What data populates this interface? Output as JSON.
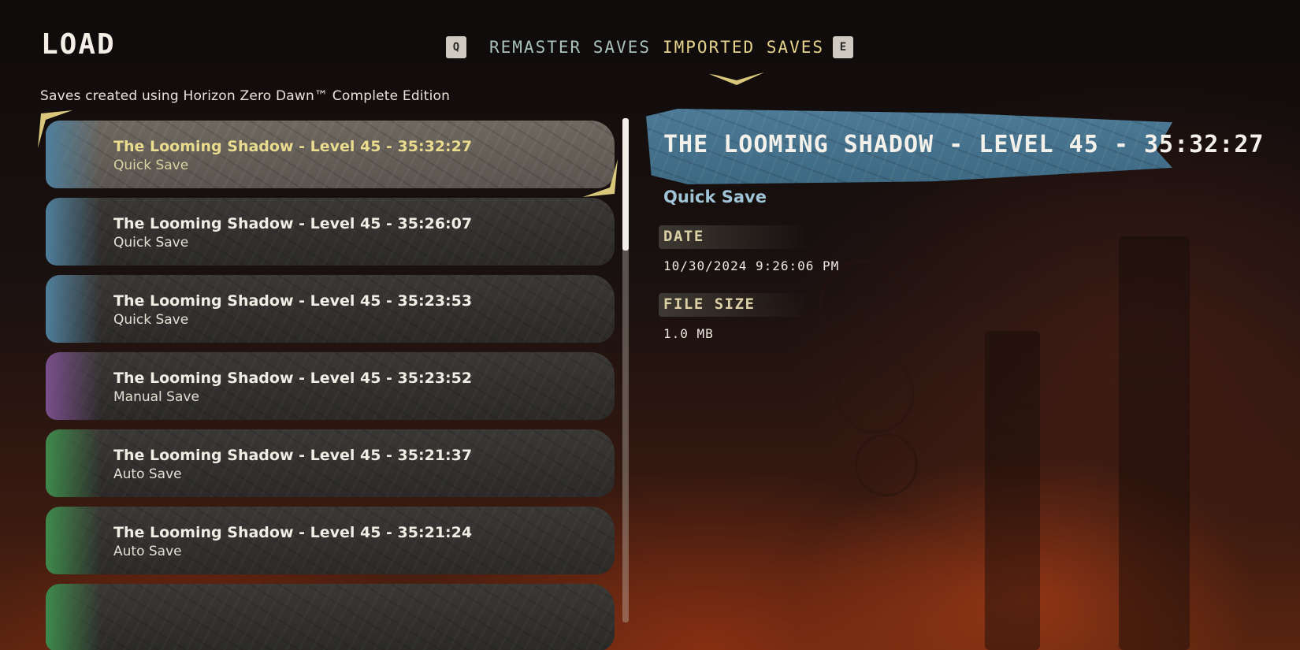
{
  "header": {
    "title": "LOAD",
    "subtitle": "Saves created using Horizon Zero Dawn™ Complete Edition"
  },
  "tabs": {
    "prev_key": "Q",
    "next_key": "E",
    "items": [
      {
        "label": "REMASTER SAVES",
        "active": false
      },
      {
        "label": "IMPORTED SAVES",
        "active": true
      }
    ]
  },
  "colors": {
    "quick_save": "#4f7f9c",
    "manual_save": "#7a4f8c",
    "auto_save": "#3f8a4c",
    "accent": "#e6d48d",
    "banner": "#456f8a"
  },
  "saves": [
    {
      "name": "The Looming Shadow - Level 45 - 35:32:27",
      "type": "Quick Save",
      "kind": "quick",
      "selected": true
    },
    {
      "name": "The Looming Shadow - Level 45 - 35:26:07",
      "type": "Quick Save",
      "kind": "quick",
      "selected": false
    },
    {
      "name": "The Looming Shadow - Level 45 - 35:23:53",
      "type": "Quick Save",
      "kind": "quick",
      "selected": false
    },
    {
      "name": "The Looming Shadow - Level 45 - 35:23:52",
      "type": "Manual Save",
      "kind": "manual",
      "selected": false
    },
    {
      "name": "The Looming Shadow - Level 45 - 35:21:37",
      "type": "Auto Save",
      "kind": "auto",
      "selected": false
    },
    {
      "name": "The Looming Shadow - Level 45 - 35:21:24",
      "type": "Auto Save",
      "kind": "auto",
      "selected": false
    }
  ],
  "detail": {
    "title": "THE LOOMING SHADOW - LEVEL 45 - 35:32:27",
    "type": "Quick Save",
    "date_label": "DATE",
    "date_value": "10/30/2024 9:26:06 PM",
    "size_label": "FILE SIZE",
    "size_value": "1.0 MB"
  }
}
